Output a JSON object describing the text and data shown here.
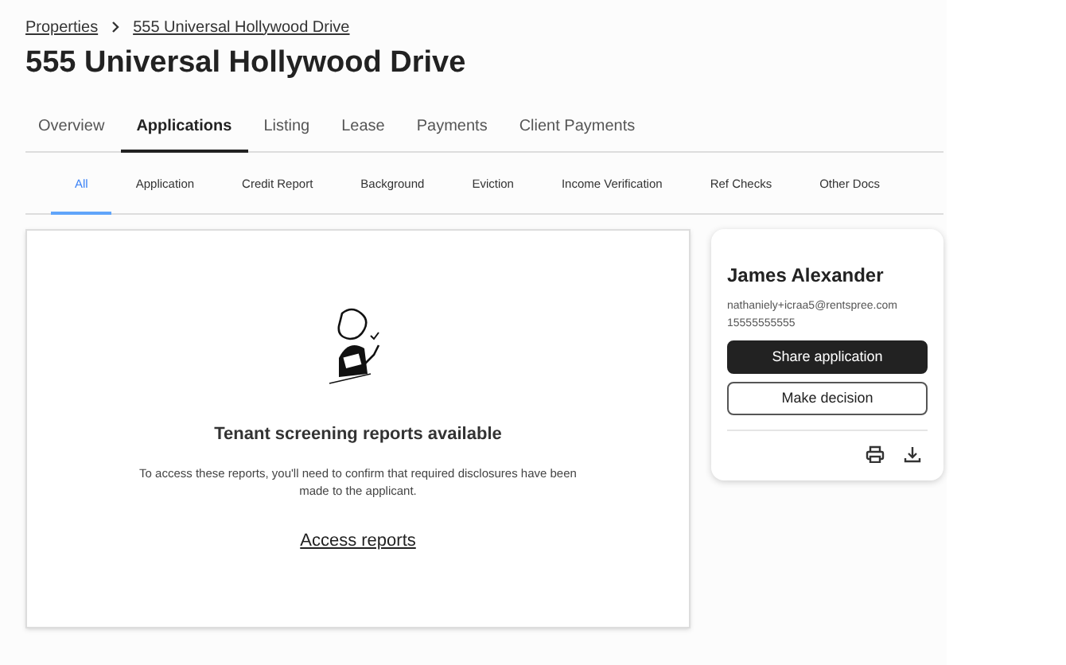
{
  "breadcrumb": [
    {
      "label": "Properties"
    },
    {
      "label": "555 Universal Hollywood Drive"
    }
  ],
  "title": "555 Universal Hollywood Drive",
  "tabs": [
    {
      "label": "Overview",
      "selected": false
    },
    {
      "label": "Applications",
      "selected": true
    },
    {
      "label": "Listing",
      "selected": false
    },
    {
      "label": "Lease",
      "selected": false
    },
    {
      "label": "Payments",
      "selected": false
    },
    {
      "label": "Client Payments",
      "selected": false
    }
  ],
  "subtabs": [
    {
      "label": "All",
      "selected": true
    },
    {
      "label": "Application",
      "selected": false
    },
    {
      "label": "Credit Report",
      "selected": false
    },
    {
      "label": "Background",
      "selected": false
    },
    {
      "label": "Eviction",
      "selected": false
    },
    {
      "label": "Income Verification",
      "selected": false
    },
    {
      "label": "Ref Checks",
      "selected": false
    },
    {
      "label": "Other Docs",
      "selected": false
    }
  ],
  "reports": {
    "heading": "Tenant screening reports available",
    "message": "To access these reports, you'll need to confirm that required disclosures have been made to the applicant.",
    "link": "Access reports"
  },
  "applicant": {
    "name": "James Alexander",
    "email": "nathaniely+icraa5@rentspree.com",
    "phone": "15555555555",
    "buttons": [
      {
        "label": "Share application",
        "kind": "primary"
      },
      {
        "label": "Make decision",
        "kind": "secondary"
      }
    ]
  }
}
